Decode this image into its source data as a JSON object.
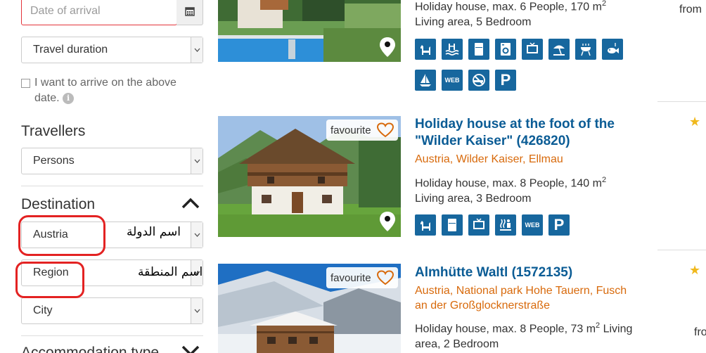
{
  "sidebar": {
    "arrival_placeholder": "Date of arrival",
    "travel_duration": "Travel duration",
    "arrive_checkbox_text": "I want to arrive on the above date.",
    "travellers_title": "Travellers",
    "persons": "Persons",
    "destination_title": "Destination",
    "country": "Austria",
    "region": "Region",
    "city": "City",
    "accommodation_title": "Accommodation type",
    "annotation_country": "اسم الدولة",
    "annotation_region": "اسم المنطقة"
  },
  "listings": [
    {
      "desc_line1": "Holiday house, max. 6 People, 170 m",
      "sup": "2",
      "desc_line2": "Living area, 5 Bedroom",
      "price_prefix": "from",
      "icons": [
        "dog-icon",
        "pool-icon",
        "fridge-icon",
        "washing-machine-icon",
        "tv-icon",
        "beach-umbrella-icon",
        "grill-icon",
        "fishing-icon",
        "sailing-icon",
        "web-icon",
        "no-smoking-icon",
        "parking-icon"
      ]
    },
    {
      "favourite": "favourite",
      "title": "Holiday house at the foot of the \"Wilder Kaiser\" (426820)",
      "location": [
        "Austria",
        "Wilder Kaiser",
        "Ellmau"
      ],
      "desc_line1": "Holiday house, max. 8 People, 140 m",
      "sup": "2",
      "desc_line2": "Living area, 3 Bedroom",
      "icons": [
        "dog-icon",
        "fridge-icon",
        "tv-icon",
        "sauna-icon",
        "web-icon",
        "parking-icon"
      ]
    },
    {
      "favourite": "favourite",
      "title": "Almhütte Waltl (1572135)",
      "location_line1": "Austria, National park Hohe Tauern, Fusch",
      "location_line2": "an der Großglocknerstraße",
      "desc_line1": "Holiday house, max. 8 People, 73 m",
      "sup": "2",
      "desc_line1_end": " Living",
      "desc_line2": "area, 2 Bedroom",
      "price_prefix": "fro"
    }
  ],
  "icon_labels": {
    "web": "WEB",
    "parking": "P"
  },
  "colors": {
    "accent_blue": "#17679e",
    "title_blue": "#0b5c95",
    "location_orange": "#d86a0c",
    "error_red": "#e3333a",
    "star": "#f0b81c"
  }
}
